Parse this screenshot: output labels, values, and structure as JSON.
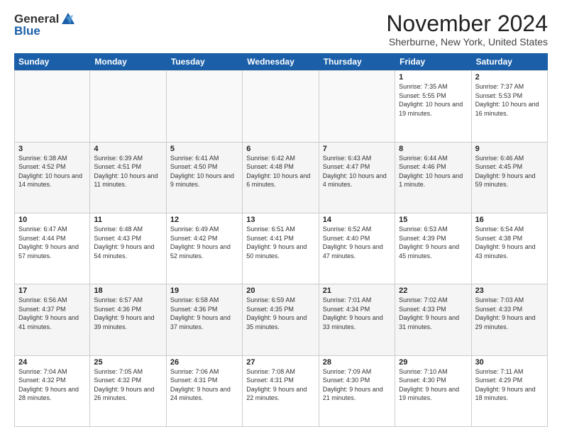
{
  "logo": {
    "line1": "General",
    "line2": "Blue"
  },
  "title": "November 2024",
  "location": "Sherburne, New York, United States",
  "weekdays": [
    "Sunday",
    "Monday",
    "Tuesday",
    "Wednesday",
    "Thursday",
    "Friday",
    "Saturday"
  ],
  "weeks": [
    [
      {
        "day": "",
        "info": ""
      },
      {
        "day": "",
        "info": ""
      },
      {
        "day": "",
        "info": ""
      },
      {
        "day": "",
        "info": ""
      },
      {
        "day": "",
        "info": ""
      },
      {
        "day": "1",
        "info": "Sunrise: 7:35 AM\nSunset: 5:55 PM\nDaylight: 10 hours and 19 minutes."
      },
      {
        "day": "2",
        "info": "Sunrise: 7:37 AM\nSunset: 5:53 PM\nDaylight: 10 hours and 16 minutes."
      }
    ],
    [
      {
        "day": "3",
        "info": "Sunrise: 6:38 AM\nSunset: 4:52 PM\nDaylight: 10 hours and 14 minutes."
      },
      {
        "day": "4",
        "info": "Sunrise: 6:39 AM\nSunset: 4:51 PM\nDaylight: 10 hours and 11 minutes."
      },
      {
        "day": "5",
        "info": "Sunrise: 6:41 AM\nSunset: 4:50 PM\nDaylight: 10 hours and 9 minutes."
      },
      {
        "day": "6",
        "info": "Sunrise: 6:42 AM\nSunset: 4:48 PM\nDaylight: 10 hours and 6 minutes."
      },
      {
        "day": "7",
        "info": "Sunrise: 6:43 AM\nSunset: 4:47 PM\nDaylight: 10 hours and 4 minutes."
      },
      {
        "day": "8",
        "info": "Sunrise: 6:44 AM\nSunset: 4:46 PM\nDaylight: 10 hours and 1 minute."
      },
      {
        "day": "9",
        "info": "Sunrise: 6:46 AM\nSunset: 4:45 PM\nDaylight: 9 hours and 59 minutes."
      }
    ],
    [
      {
        "day": "10",
        "info": "Sunrise: 6:47 AM\nSunset: 4:44 PM\nDaylight: 9 hours and 57 minutes."
      },
      {
        "day": "11",
        "info": "Sunrise: 6:48 AM\nSunset: 4:43 PM\nDaylight: 9 hours and 54 minutes."
      },
      {
        "day": "12",
        "info": "Sunrise: 6:49 AM\nSunset: 4:42 PM\nDaylight: 9 hours and 52 minutes."
      },
      {
        "day": "13",
        "info": "Sunrise: 6:51 AM\nSunset: 4:41 PM\nDaylight: 9 hours and 50 minutes."
      },
      {
        "day": "14",
        "info": "Sunrise: 6:52 AM\nSunset: 4:40 PM\nDaylight: 9 hours and 47 minutes."
      },
      {
        "day": "15",
        "info": "Sunrise: 6:53 AM\nSunset: 4:39 PM\nDaylight: 9 hours and 45 minutes."
      },
      {
        "day": "16",
        "info": "Sunrise: 6:54 AM\nSunset: 4:38 PM\nDaylight: 9 hours and 43 minutes."
      }
    ],
    [
      {
        "day": "17",
        "info": "Sunrise: 6:56 AM\nSunset: 4:37 PM\nDaylight: 9 hours and 41 minutes."
      },
      {
        "day": "18",
        "info": "Sunrise: 6:57 AM\nSunset: 4:36 PM\nDaylight: 9 hours and 39 minutes."
      },
      {
        "day": "19",
        "info": "Sunrise: 6:58 AM\nSunset: 4:36 PM\nDaylight: 9 hours and 37 minutes."
      },
      {
        "day": "20",
        "info": "Sunrise: 6:59 AM\nSunset: 4:35 PM\nDaylight: 9 hours and 35 minutes."
      },
      {
        "day": "21",
        "info": "Sunrise: 7:01 AM\nSunset: 4:34 PM\nDaylight: 9 hours and 33 minutes."
      },
      {
        "day": "22",
        "info": "Sunrise: 7:02 AM\nSunset: 4:33 PM\nDaylight: 9 hours and 31 minutes."
      },
      {
        "day": "23",
        "info": "Sunrise: 7:03 AM\nSunset: 4:33 PM\nDaylight: 9 hours and 29 minutes."
      }
    ],
    [
      {
        "day": "24",
        "info": "Sunrise: 7:04 AM\nSunset: 4:32 PM\nDaylight: 9 hours and 28 minutes."
      },
      {
        "day": "25",
        "info": "Sunrise: 7:05 AM\nSunset: 4:32 PM\nDaylight: 9 hours and 26 minutes."
      },
      {
        "day": "26",
        "info": "Sunrise: 7:06 AM\nSunset: 4:31 PM\nDaylight: 9 hours and 24 minutes."
      },
      {
        "day": "27",
        "info": "Sunrise: 7:08 AM\nSunset: 4:31 PM\nDaylight: 9 hours and 22 minutes."
      },
      {
        "day": "28",
        "info": "Sunrise: 7:09 AM\nSunset: 4:30 PM\nDaylight: 9 hours and 21 minutes."
      },
      {
        "day": "29",
        "info": "Sunrise: 7:10 AM\nSunset: 4:30 PM\nDaylight: 9 hours and 19 minutes."
      },
      {
        "day": "30",
        "info": "Sunrise: 7:11 AM\nSunset: 4:29 PM\nDaylight: 9 hours and 18 minutes."
      }
    ]
  ]
}
